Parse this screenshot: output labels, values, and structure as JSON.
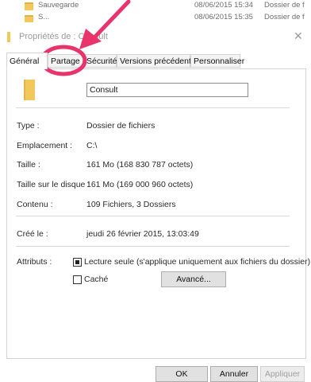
{
  "background_rows": [
    {
      "name": "Sauvegarde",
      "date": "08/06/2015 15:34",
      "type": "Dossier de f"
    },
    {
      "name": "S...",
      "date": "08/06/2015 15:35",
      "type": "Dossier de f"
    }
  ],
  "dialog": {
    "title": "Propriétés de : Consult",
    "tabs": [
      "Général",
      "Partage",
      "Sécurité",
      "Versions précédentes",
      "Personnaliser"
    ],
    "active_tab": "Général",
    "folder_name": "Consult",
    "fields": [
      {
        "label": "Type :",
        "value": "Dossier de fichiers"
      },
      {
        "label": "Emplacement :",
        "value": "C:\\"
      },
      {
        "label": "Taille :",
        "value": "161 Mo (168 830 787 octets)"
      },
      {
        "label": "Taille sur le disque :",
        "value": "161 Mo (169 000 960 octets)"
      },
      {
        "label": "Contenu :",
        "value": "109 Fichiers, 3 Dossiers"
      },
      {
        "label": "Créé le :",
        "value": "jeudi 26 février 2015, 13:03:49"
      }
    ],
    "attributes": {
      "label": "Attributs :",
      "readonly_label": "Lecture seule (s'applique uniquement aux fichiers du dossier)",
      "readonly_state": "indeterminate",
      "hidden_label": "Caché",
      "hidden_checked": false,
      "advanced_button": "Avancé..."
    },
    "buttons": {
      "ok": "OK",
      "cancel": "Annuler",
      "apply": "Appliquer"
    }
  },
  "annotation": {
    "highlight_color": "#e8336d",
    "target": "Partage"
  }
}
